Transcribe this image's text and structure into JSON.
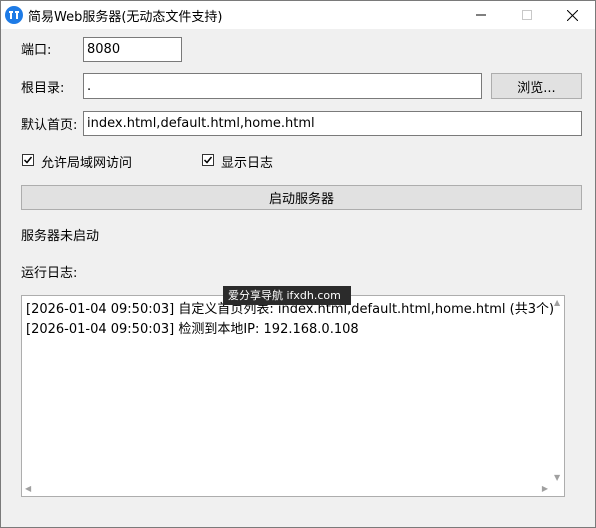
{
  "window": {
    "title": "简易Web服务器(无动态文件支持)",
    "icon": "app-logo-icon",
    "controls": {
      "minimize_icon": "minimize-icon",
      "maximize_icon": "maximize-icon",
      "close_icon": "close-icon"
    }
  },
  "form": {
    "port_label": "端口:",
    "port_value": "8080",
    "root_label": "根目录:",
    "root_value": ".",
    "browse_label": "浏览...",
    "index_label": "默认首页:",
    "index_value": "index.html,default.html,home.html",
    "lan_label": "允许局域网访问",
    "lan_checked": true,
    "showlog_label": "显示日志",
    "showlog_checked": true,
    "start_label": "启动服务器"
  },
  "status": {
    "text": "服务器未启动"
  },
  "log": {
    "label": "运行日志:",
    "lines": [
      "[2026-01-04 09:50:03] 自定义首页列表: index.html,default.html,home.html (共3个)",
      "[2026-01-04 09:50:03] 检测到本地IP: 192.168.0.108"
    ]
  },
  "watermark": {
    "text": "爱分享导航 ifxdh.com"
  },
  "colors": {
    "icon_blue": "#1e7be6",
    "window_bg": "#f0f0f0",
    "button_bg": "#e1e1e1"
  }
}
